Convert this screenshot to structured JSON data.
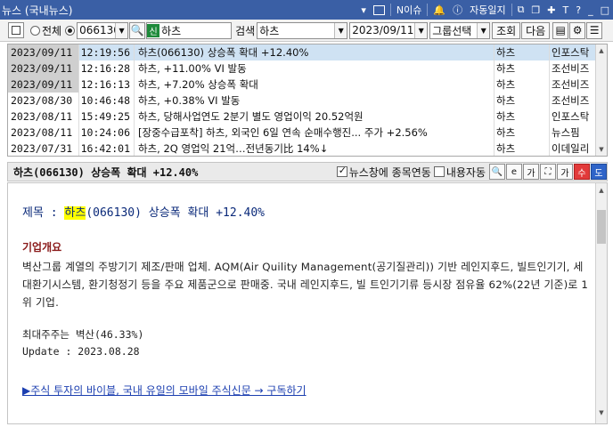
{
  "window": {
    "title": "뉴스 (국내뉴스)",
    "buttons": {
      "issue": "N이슈",
      "auto_journal": "자동일지"
    }
  },
  "toolbar": {
    "radio_all": "전체",
    "code_value": "066130",
    "stock_name": "하츠",
    "search_label": "검색",
    "search_value": "하츠",
    "date_value": "2023/09/11",
    "group_select": "그룹선택",
    "query_button": "조회",
    "next_button": "다음"
  },
  "news_list": [
    {
      "date": "2023/09/11",
      "time": "12:19:56",
      "title": "하츠(066130) 상승폭 확대 +12.40%",
      "stock": "하츠",
      "source": "인포스탁"
    },
    {
      "date": "2023/09/11",
      "time": "12:16:28",
      "title": "하츠, +11.00% VI 발동",
      "stock": "하츠",
      "source": "조선비즈"
    },
    {
      "date": "2023/09/11",
      "time": "12:16:13",
      "title": "하츠, +7.20% 상승폭 확대",
      "stock": "하츠",
      "source": "조선비즈"
    },
    {
      "date": "2023/08/30",
      "time": "10:46:48",
      "title": "하츠, +0.38% VI 발동",
      "stock": "하츠",
      "source": "조선비즈"
    },
    {
      "date": "2023/08/11",
      "time": "15:49:25",
      "title": "하츠, 당해사업연도 2분기 별도 영업이익 20.52억원",
      "stock": "하츠",
      "source": "인포스탁"
    },
    {
      "date": "2023/08/11",
      "time": "10:24:06",
      "title": "[장중수급포착] 하츠, 외국인 6일 연속 순매수행진... 주가 +2.56%",
      "stock": "하츠",
      "source": "뉴스핌"
    },
    {
      "date": "2023/07/31",
      "time": "16:42:01",
      "title": "하츠, 2Q 영업익 21억…전년동기比 14%↓",
      "stock": "하츠",
      "source": "이데일리"
    }
  ],
  "detail": {
    "headline": "하츠(066130) 상승폭 확대 +12.40%",
    "link_checkbox": "뉴스창에 종목연동",
    "auto_checkbox": "내용자동",
    "subject_prefix": "제목 : ",
    "subject_highlight": "하츠",
    "subject_rest": "(066130) 상승폭 확대 +12.40%",
    "section_title": "기업개요",
    "overview": "벽산그룹 계열의 주방기기 제조/판매 업체. AQM(Air Quility Management(공기질관리)) 기반 레인지후드, 빌트인기기, 세대환기시스템, 환기청정기 등을 주요 제품군으로 판매중. 국내 레인지후드, 빌 트인기기류 등시장 점유율 62%(22년 기준)로 1위 기업.",
    "major_holder": "최대주주는 벽산(46.33%)",
    "update": "Update : 2023.08.28",
    "promo": "▶주식 투자의 바이블, 국내 유일의 모바일 주식신문 → 구독하기"
  },
  "colors": {
    "titlebar": "#3a5fa5",
    "selected_row": "#cfe2f3",
    "highlight": "#ffff00",
    "section": "#8a1a1a",
    "link": "#1c3fb0"
  }
}
